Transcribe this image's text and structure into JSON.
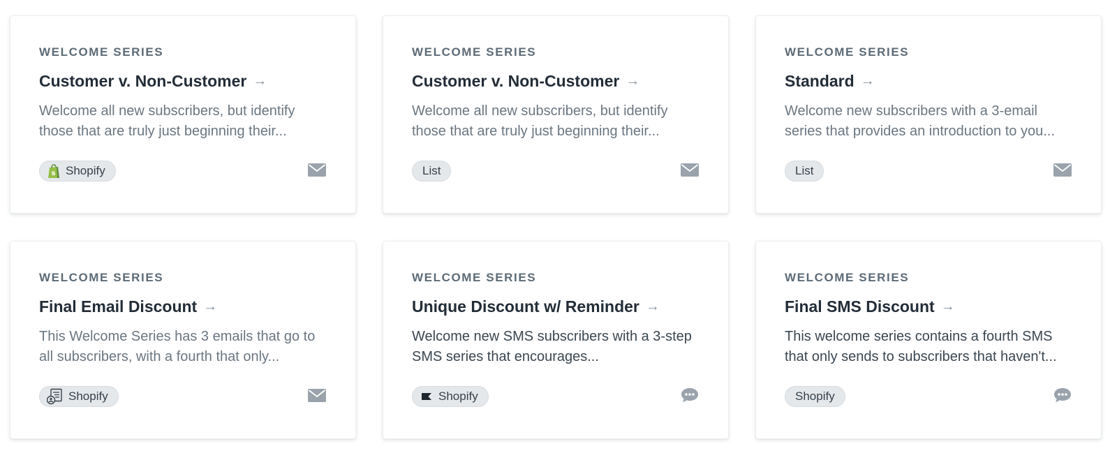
{
  "cards": [
    {
      "eyebrow": "WELCOME SERIES",
      "title": "Customer v. Non-Customer",
      "description": "Welcome all new subscribers, but identify those that are truly just beginning their...",
      "tag": "Shopify",
      "tag_icon": "shopify-bag-icon",
      "channel_icon": "envelope-icon"
    },
    {
      "eyebrow": "WELCOME SERIES",
      "title": "Customer v. Non-Customer",
      "description": "Welcome all new subscribers, but identify those that are truly just beginning their...",
      "tag": "List",
      "tag_icon": "",
      "channel_icon": "envelope-icon"
    },
    {
      "eyebrow": "WELCOME SERIES",
      "title": "Standard",
      "description": "Welcome new subscribers with a 3-email series that provides an introduction to you...",
      "tag": "List",
      "tag_icon": "",
      "channel_icon": "envelope-icon"
    },
    {
      "eyebrow": "WELCOME SERIES",
      "title": "Final Email Discount",
      "description": "This Welcome Series has 3 emails that go to all subscribers, with a fourth that only...",
      "tag": "Shopify",
      "tag_icon": "subscriber-list-icon",
      "channel_icon": "envelope-icon"
    },
    {
      "eyebrow": "WELCOME SERIES",
      "title": "Unique Discount w/ Reminder",
      "description": "Welcome new SMS subscribers with a 3-step SMS series that encourages...",
      "tag": "Shopify",
      "tag_icon": "flag-icon",
      "channel_icon": "sms-bubble-icon"
    },
    {
      "eyebrow": "WELCOME SERIES",
      "title": "Final SMS Discount",
      "description": "This welcome series contains a fourth SMS that only sends to subscribers that haven't...",
      "tag": "Shopify",
      "tag_icon": "",
      "channel_icon": "sms-bubble-icon"
    }
  ],
  "colors": {
    "title": "#232d37",
    "eyebrow": "#5d6b76",
    "description": "#6b7680",
    "tag_background": "#e5e8eb",
    "icon_gray": "#9aa3ab",
    "shopify_green": "#95bf47"
  }
}
